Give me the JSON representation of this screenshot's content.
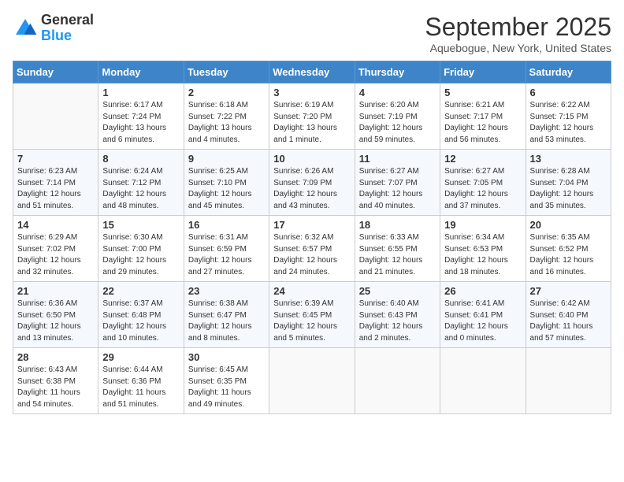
{
  "header": {
    "logo_general": "General",
    "logo_blue": "Blue",
    "month_title": "September 2025",
    "subtitle": "Aquebogue, New York, United States"
  },
  "days_of_week": [
    "Sunday",
    "Monday",
    "Tuesday",
    "Wednesday",
    "Thursday",
    "Friday",
    "Saturday"
  ],
  "weeks": [
    [
      {
        "num": "",
        "sunrise": "",
        "sunset": "",
        "daylight": ""
      },
      {
        "num": "1",
        "sunrise": "Sunrise: 6:17 AM",
        "sunset": "Sunset: 7:24 PM",
        "daylight": "Daylight: 13 hours and 6 minutes."
      },
      {
        "num": "2",
        "sunrise": "Sunrise: 6:18 AM",
        "sunset": "Sunset: 7:22 PM",
        "daylight": "Daylight: 13 hours and 4 minutes."
      },
      {
        "num": "3",
        "sunrise": "Sunrise: 6:19 AM",
        "sunset": "Sunset: 7:20 PM",
        "daylight": "Daylight: 13 hours and 1 minute."
      },
      {
        "num": "4",
        "sunrise": "Sunrise: 6:20 AM",
        "sunset": "Sunset: 7:19 PM",
        "daylight": "Daylight: 12 hours and 59 minutes."
      },
      {
        "num": "5",
        "sunrise": "Sunrise: 6:21 AM",
        "sunset": "Sunset: 7:17 PM",
        "daylight": "Daylight: 12 hours and 56 minutes."
      },
      {
        "num": "6",
        "sunrise": "Sunrise: 6:22 AM",
        "sunset": "Sunset: 7:15 PM",
        "daylight": "Daylight: 12 hours and 53 minutes."
      }
    ],
    [
      {
        "num": "7",
        "sunrise": "Sunrise: 6:23 AM",
        "sunset": "Sunset: 7:14 PM",
        "daylight": "Daylight: 12 hours and 51 minutes."
      },
      {
        "num": "8",
        "sunrise": "Sunrise: 6:24 AM",
        "sunset": "Sunset: 7:12 PM",
        "daylight": "Daylight: 12 hours and 48 minutes."
      },
      {
        "num": "9",
        "sunrise": "Sunrise: 6:25 AM",
        "sunset": "Sunset: 7:10 PM",
        "daylight": "Daylight: 12 hours and 45 minutes."
      },
      {
        "num": "10",
        "sunrise": "Sunrise: 6:26 AM",
        "sunset": "Sunset: 7:09 PM",
        "daylight": "Daylight: 12 hours and 43 minutes."
      },
      {
        "num": "11",
        "sunrise": "Sunrise: 6:27 AM",
        "sunset": "Sunset: 7:07 PM",
        "daylight": "Daylight: 12 hours and 40 minutes."
      },
      {
        "num": "12",
        "sunrise": "Sunrise: 6:27 AM",
        "sunset": "Sunset: 7:05 PM",
        "daylight": "Daylight: 12 hours and 37 minutes."
      },
      {
        "num": "13",
        "sunrise": "Sunrise: 6:28 AM",
        "sunset": "Sunset: 7:04 PM",
        "daylight": "Daylight: 12 hours and 35 minutes."
      }
    ],
    [
      {
        "num": "14",
        "sunrise": "Sunrise: 6:29 AM",
        "sunset": "Sunset: 7:02 PM",
        "daylight": "Daylight: 12 hours and 32 minutes."
      },
      {
        "num": "15",
        "sunrise": "Sunrise: 6:30 AM",
        "sunset": "Sunset: 7:00 PM",
        "daylight": "Daylight: 12 hours and 29 minutes."
      },
      {
        "num": "16",
        "sunrise": "Sunrise: 6:31 AM",
        "sunset": "Sunset: 6:59 PM",
        "daylight": "Daylight: 12 hours and 27 minutes."
      },
      {
        "num": "17",
        "sunrise": "Sunrise: 6:32 AM",
        "sunset": "Sunset: 6:57 PM",
        "daylight": "Daylight: 12 hours and 24 minutes."
      },
      {
        "num": "18",
        "sunrise": "Sunrise: 6:33 AM",
        "sunset": "Sunset: 6:55 PM",
        "daylight": "Daylight: 12 hours and 21 minutes."
      },
      {
        "num": "19",
        "sunrise": "Sunrise: 6:34 AM",
        "sunset": "Sunset: 6:53 PM",
        "daylight": "Daylight: 12 hours and 18 minutes."
      },
      {
        "num": "20",
        "sunrise": "Sunrise: 6:35 AM",
        "sunset": "Sunset: 6:52 PM",
        "daylight": "Daylight: 12 hours and 16 minutes."
      }
    ],
    [
      {
        "num": "21",
        "sunrise": "Sunrise: 6:36 AM",
        "sunset": "Sunset: 6:50 PM",
        "daylight": "Daylight: 12 hours and 13 minutes."
      },
      {
        "num": "22",
        "sunrise": "Sunrise: 6:37 AM",
        "sunset": "Sunset: 6:48 PM",
        "daylight": "Daylight: 12 hours and 10 minutes."
      },
      {
        "num": "23",
        "sunrise": "Sunrise: 6:38 AM",
        "sunset": "Sunset: 6:47 PM",
        "daylight": "Daylight: 12 hours and 8 minutes."
      },
      {
        "num": "24",
        "sunrise": "Sunrise: 6:39 AM",
        "sunset": "Sunset: 6:45 PM",
        "daylight": "Daylight: 12 hours and 5 minutes."
      },
      {
        "num": "25",
        "sunrise": "Sunrise: 6:40 AM",
        "sunset": "Sunset: 6:43 PM",
        "daylight": "Daylight: 12 hours and 2 minutes."
      },
      {
        "num": "26",
        "sunrise": "Sunrise: 6:41 AM",
        "sunset": "Sunset: 6:41 PM",
        "daylight": "Daylight: 12 hours and 0 minutes."
      },
      {
        "num": "27",
        "sunrise": "Sunrise: 6:42 AM",
        "sunset": "Sunset: 6:40 PM",
        "daylight": "Daylight: 11 hours and 57 minutes."
      }
    ],
    [
      {
        "num": "28",
        "sunrise": "Sunrise: 6:43 AM",
        "sunset": "Sunset: 6:38 PM",
        "daylight": "Daylight: 11 hours and 54 minutes."
      },
      {
        "num": "29",
        "sunrise": "Sunrise: 6:44 AM",
        "sunset": "Sunset: 6:36 PM",
        "daylight": "Daylight: 11 hours and 51 minutes."
      },
      {
        "num": "30",
        "sunrise": "Sunrise: 6:45 AM",
        "sunset": "Sunset: 6:35 PM",
        "daylight": "Daylight: 11 hours and 49 minutes."
      },
      {
        "num": "",
        "sunrise": "",
        "sunset": "",
        "daylight": ""
      },
      {
        "num": "",
        "sunrise": "",
        "sunset": "",
        "daylight": ""
      },
      {
        "num": "",
        "sunrise": "",
        "sunset": "",
        "daylight": ""
      },
      {
        "num": "",
        "sunrise": "",
        "sunset": "",
        "daylight": ""
      }
    ]
  ]
}
